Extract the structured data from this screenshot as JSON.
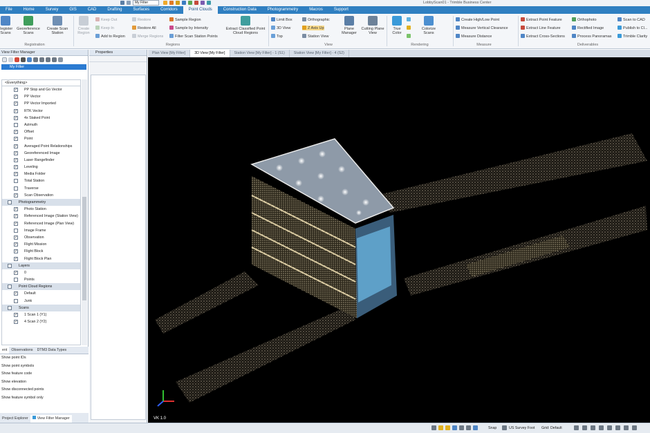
{
  "app": {
    "title": "LobbyScan01 - Trimble Business Center"
  },
  "quick_access": {
    "filter_value": "My Filter"
  },
  "ribbon_tabs": [
    "File",
    "Home",
    "Survey",
    "GIS",
    "CAD",
    "Drafting",
    "Surfaces",
    "Corridors",
    "Point Clouds",
    "Construction Data",
    "Photogrammetry",
    "Macros",
    "Support"
  ],
  "ribbon": {
    "register_scans": "Register Scans",
    "georeference_scans": "Georeference Scans",
    "create_scan_station": "Create Scan Station",
    "registration_group": "Registration",
    "create_region": "Create Region",
    "keep_out": "Keep Out",
    "keep_in": "Keep In",
    "add_to_region": "Add to Region",
    "restore": "Restore",
    "restore_all": "Restore All",
    "merge_regions": "Merge Regions",
    "sample_region": "Sample Region",
    "sample_by_intensity": "Sample by Intensity",
    "filter_scan_station_points": "Filter Scan Station Points",
    "extract_classified": "Extract Classified Point Cloud Regions",
    "regions_group": "Regions",
    "limit_box": "Limit Box",
    "view_3d": "3D View",
    "top": "Top",
    "orthographic": "Orthographic",
    "z_axis_up": "Z Axis Up",
    "station_view": "Station View",
    "plane_manager": "Plane Manager",
    "cutting_plane_view": "Cutting Plane View",
    "view_group": "View",
    "true_color": "True Color",
    "colorize_scans": "Colorize Scans",
    "rendering_group": "Rendering",
    "create_high_low": "Create High/Low Point",
    "measure_vertical": "Measure Vertical Clearance",
    "measure_distance": "Measure Distance",
    "measure_group": "Measure",
    "extract_point_feature": "Extract Point Feature",
    "extract_line_feature": "Extract Line Feature",
    "extract_cross_sections": "Extract Cross-Sections",
    "orthophoto": "Orthophoto",
    "rectified_image": "Rectified Image",
    "process_panoramas": "Process Panoramas",
    "scan_to_cad": "Scan to CAD",
    "publish_to_clarity": "Publish to Cl...",
    "trimble_clarity": "Trimble Clarity",
    "deliverables_group": "Deliverables"
  },
  "view_filter_manager": {
    "title": "View Filter Manager",
    "filter_name": "My Filter",
    "everything_label": "<Everything>",
    "items": [
      {
        "label": "PP Stop and Go Vector",
        "checked": true
      },
      {
        "label": "PP Vector",
        "checked": true
      },
      {
        "label": "PP Vector Imported",
        "checked": true
      },
      {
        "label": "RTK Vector",
        "checked": true
      },
      {
        "label": "4x Staked Point",
        "checked": true
      },
      {
        "label": "Azimuth",
        "checked": false
      },
      {
        "label": "Offset",
        "checked": true
      },
      {
        "label": "Point",
        "checked": true
      },
      {
        "label": "Averaged Point Relationships",
        "checked": true
      },
      {
        "label": "Georeferenced Image",
        "checked": true
      },
      {
        "label": "Laser Rangefinder",
        "checked": true
      },
      {
        "label": "Leveling",
        "checked": true
      },
      {
        "label": "Media Folder",
        "checked": true
      },
      {
        "label": "Total Station",
        "checked": false
      },
      {
        "label": "Traverse",
        "checked": false
      },
      {
        "label": "Scan Observation",
        "checked": true
      }
    ],
    "photogrammetry_group": "Photogrammetry",
    "photogrammetry_items": [
      {
        "label": "Photo Station",
        "checked": true
      },
      {
        "label": "Referenced Image (Station View)",
        "checked": true
      },
      {
        "label": "Referenced Image (Plan View)",
        "checked": true
      },
      {
        "label": "Image Frame",
        "checked": false
      },
      {
        "label": "Observation",
        "checked": true
      },
      {
        "label": "Flight Mission",
        "checked": true
      },
      {
        "label": "Flight Block",
        "checked": true
      },
      {
        "label": "Flight Block Plan",
        "checked": true
      }
    ],
    "layers_group": "Layers",
    "layers_items": [
      {
        "label": "0",
        "checked": true
      },
      {
        "label": "Points",
        "checked": false
      }
    ],
    "regions_group": "Point Cloud Regions",
    "regions_items": [
      {
        "label": "Default",
        "checked": true
      },
      {
        "label": "Junk",
        "checked": false
      }
    ],
    "scans_group": "Scans",
    "scans_items": [
      {
        "label": "1 Scan 1 (Y1)",
        "checked": true
      },
      {
        "label": "4 Scan 2 (Y2)",
        "checked": true
      }
    ]
  },
  "lower_panel": {
    "tabs": [
      "ent",
      "Observations",
      "DTM3 Data Types"
    ],
    "options": [
      "Show point IDs",
      "Show point symbols",
      "Show feature code",
      "Show elevation",
      "Show disconnected points",
      "Show feature symbol only"
    ],
    "bottom_tabs": [
      "Project Explorer",
      "View Filter Manager"
    ]
  },
  "properties": {
    "title": "Properties"
  },
  "view_tabs": [
    "Plan View [My Filter]",
    "3D View [My Filter]",
    "Station View [My Filter] - 1 (S1)",
    "Station View [My Filter] - 4 (S2)"
  ],
  "viewport": {
    "corner_label": "VK 1.0"
  },
  "statusbar": {
    "snap": "Snap",
    "units": "US Survey Foot",
    "grid": "Grid: Default"
  }
}
